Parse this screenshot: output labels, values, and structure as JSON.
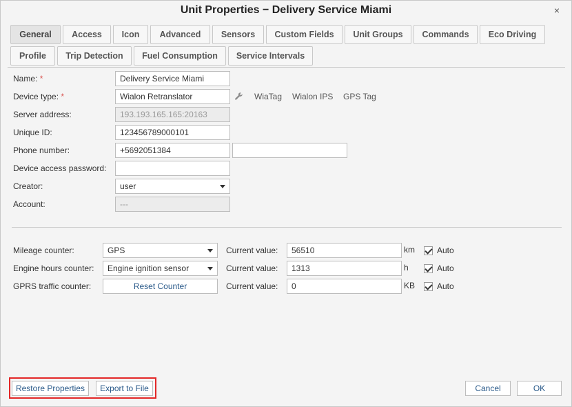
{
  "window": {
    "title": "Unit Properties − Delivery Service Miami",
    "close_glyph": "×"
  },
  "tabs": [
    {
      "label": "General"
    },
    {
      "label": "Access"
    },
    {
      "label": "Icon"
    },
    {
      "label": "Advanced"
    },
    {
      "label": "Sensors"
    },
    {
      "label": "Custom Fields"
    },
    {
      "label": "Unit Groups"
    },
    {
      "label": "Commands"
    },
    {
      "label": "Eco Driving"
    },
    {
      "label": "Profile"
    },
    {
      "label": "Trip Detection"
    },
    {
      "label": "Fuel Consumption"
    },
    {
      "label": "Service Intervals"
    }
  ],
  "active_tab": "General",
  "form": {
    "name": {
      "label": "Name:",
      "required": "*",
      "value": "Delivery Service Miami"
    },
    "device_type": {
      "label": "Device type:",
      "required": "*",
      "value": "Wialon Retranslator",
      "links": [
        "WiaTag",
        "Wialon IPS",
        "GPS Tag"
      ],
      "icon": "wrench-icon"
    },
    "server_address": {
      "label": "Server address:",
      "value": "193.193.165.165:20163"
    },
    "unique_id": {
      "label": "Unique ID:",
      "value": "123456789000101"
    },
    "phone": {
      "label": "Phone number:",
      "value": "+5692051384",
      "value2": ""
    },
    "password": {
      "label": "Device access password:",
      "value": ""
    },
    "creator": {
      "label": "Creator:",
      "value": "user"
    },
    "account": {
      "label": "Account:",
      "value": "---"
    }
  },
  "counters": {
    "current_label": "Current value:",
    "auto_label": "Auto",
    "mileage": {
      "label": "Mileage counter:",
      "select": "GPS",
      "value": "56510",
      "unit": "km",
      "auto": true
    },
    "engine": {
      "label": "Engine hours counter:",
      "select": "Engine ignition sensor",
      "value": "1313",
      "unit": "h",
      "auto": true
    },
    "gprs": {
      "label": "GPRS traffic counter:",
      "button": "Reset Counter",
      "value": "0",
      "unit": "KB",
      "auto": true
    }
  },
  "footer": {
    "restore": "Restore Properties",
    "export": "Export to File",
    "cancel": "Cancel",
    "ok": "OK"
  },
  "colors": {
    "highlight": "#e32727",
    "required": "#d9534f",
    "link": "#2a5a8a"
  }
}
